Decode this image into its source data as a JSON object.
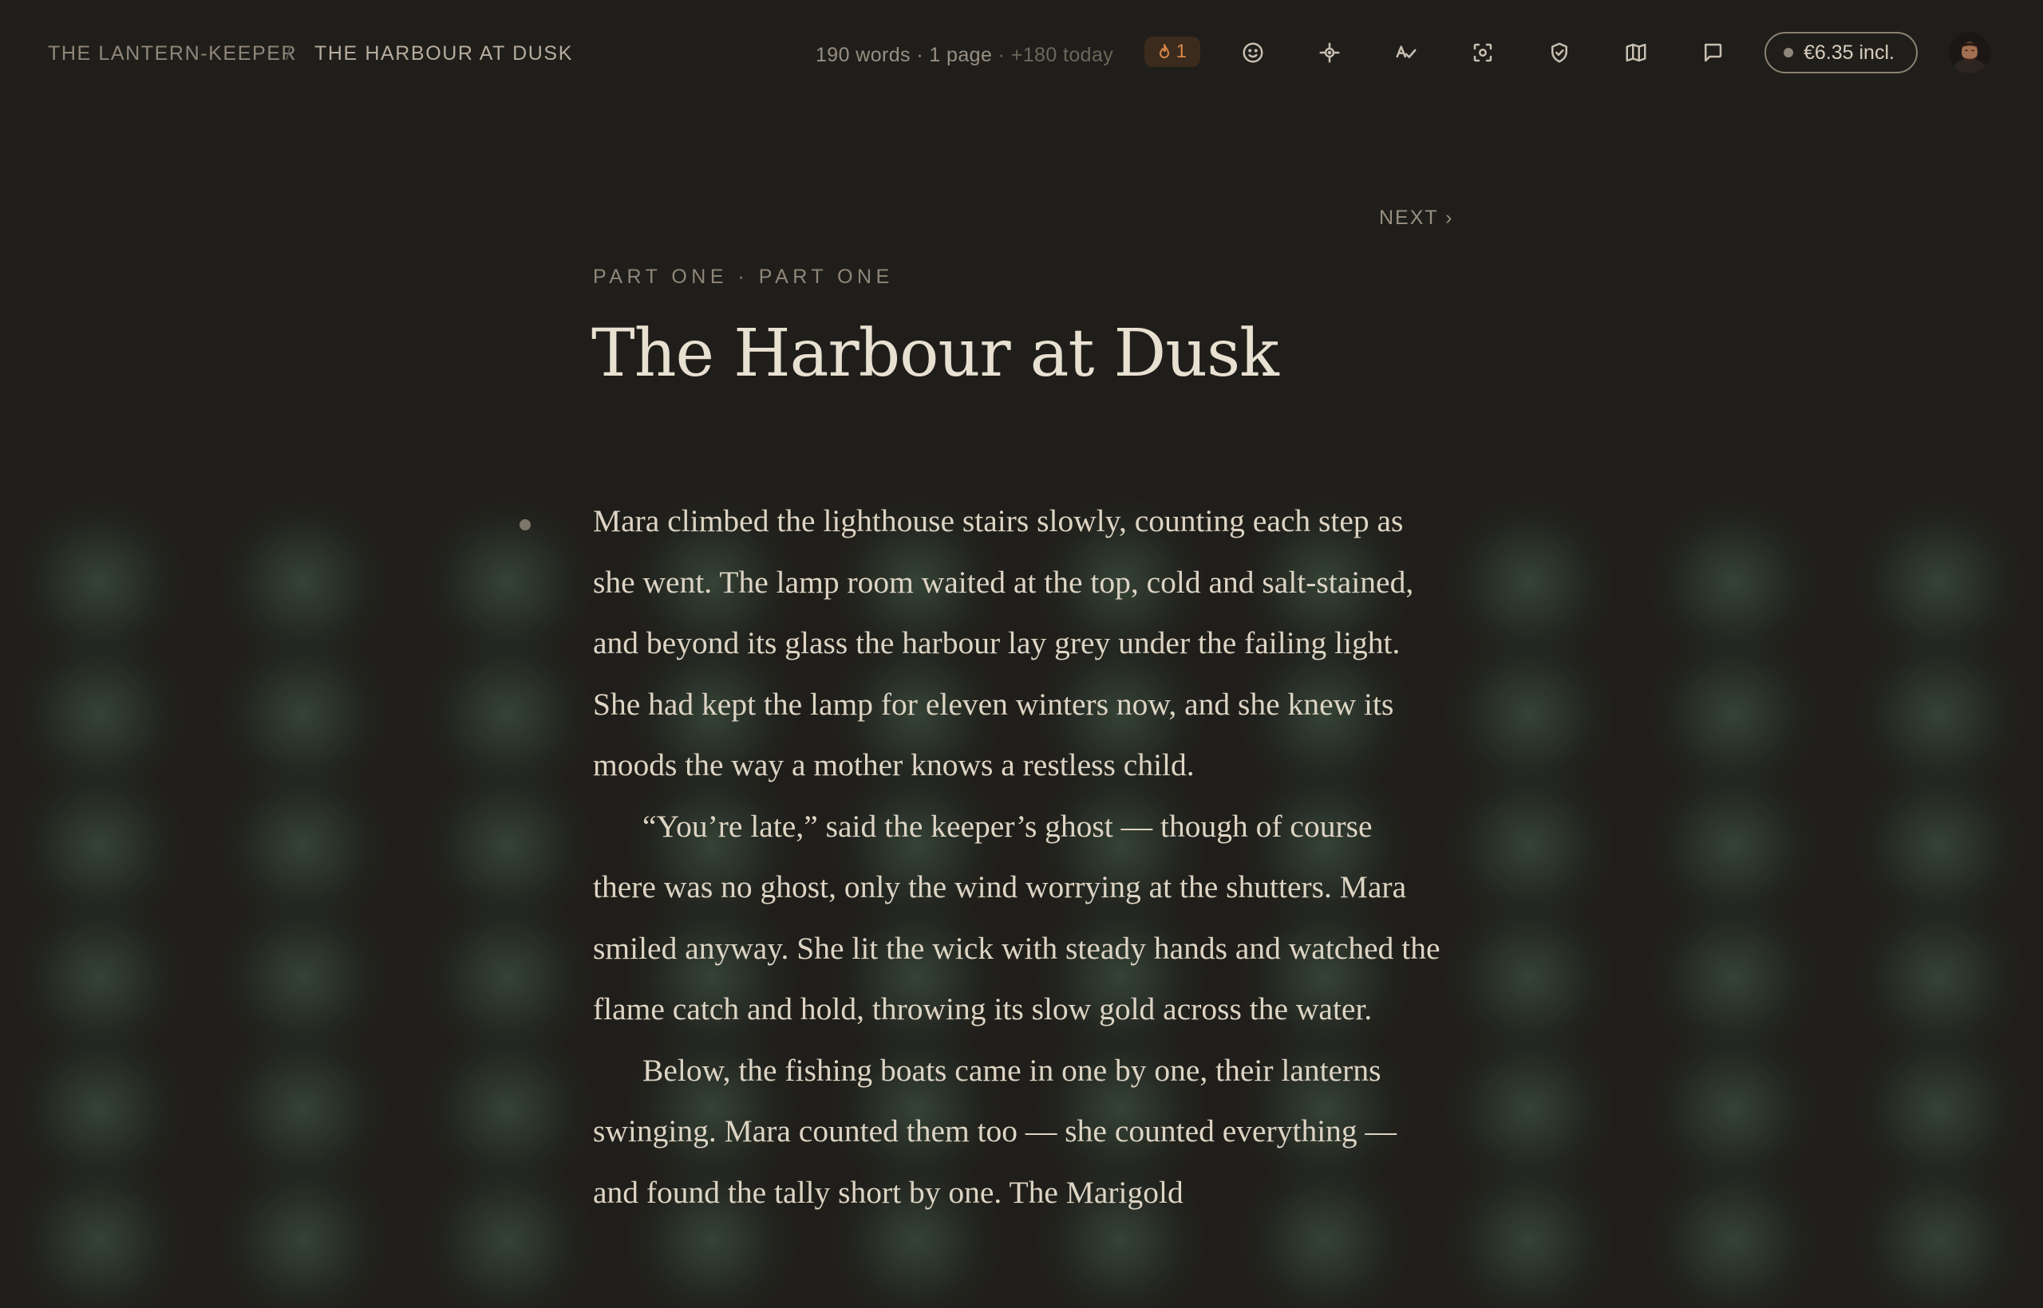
{
  "breadcrumb": {
    "book": "THE LANTERN-KEEPER",
    "separator": "/",
    "chapter": "THE HARBOUR AT DUSK"
  },
  "stats": {
    "words": "190 words",
    "pages": "1 page",
    "today": "+180 today",
    "separator": "·"
  },
  "streak": {
    "icon": "flame-icon",
    "count": "1"
  },
  "toolbar": {
    "icons": [
      "smiley-icon",
      "focus-crosshair-icon",
      "spellcheck-icon",
      "screenshot-icon",
      "shield-check-icon",
      "map-icon",
      "comment-icon"
    ]
  },
  "credits": {
    "label": "€6.35 incl."
  },
  "navigation": {
    "next": "NEXT ›"
  },
  "chapter": {
    "kicker": "PART ONE · PART ONE",
    "title": "The Harbour at Dusk"
  },
  "paragraphs": [
    "Mara climbed the lighthouse stairs slowly, counting each step as she went. The lamp room waited at the top, cold and salt-stained, and beyond its glass the harbour lay grey under the failing light. She had kept the lamp for eleven winters now, and she knew its moods the way a mother knows a restless child.",
    "“You’re late,” said the keeper’s ghost — though of course there was no ghost, only the wind worrying at the shutters. Mara smiled anyway. She lit the wick with steady hands and watched the flame catch and hold, throwing its slow gold across the water.",
    "Below, the fishing boats came in one by one, their lanterns swinging. Mara counted them too — she counted everything — and found the tally short by one. The Marigold"
  ],
  "colors": {
    "background": "#201e1a",
    "text": "#ddd4c4",
    "title": "#e8e0d1",
    "muted": "#8f877a",
    "streak_accent": "#d7874a",
    "glow": "#46604c"
  }
}
